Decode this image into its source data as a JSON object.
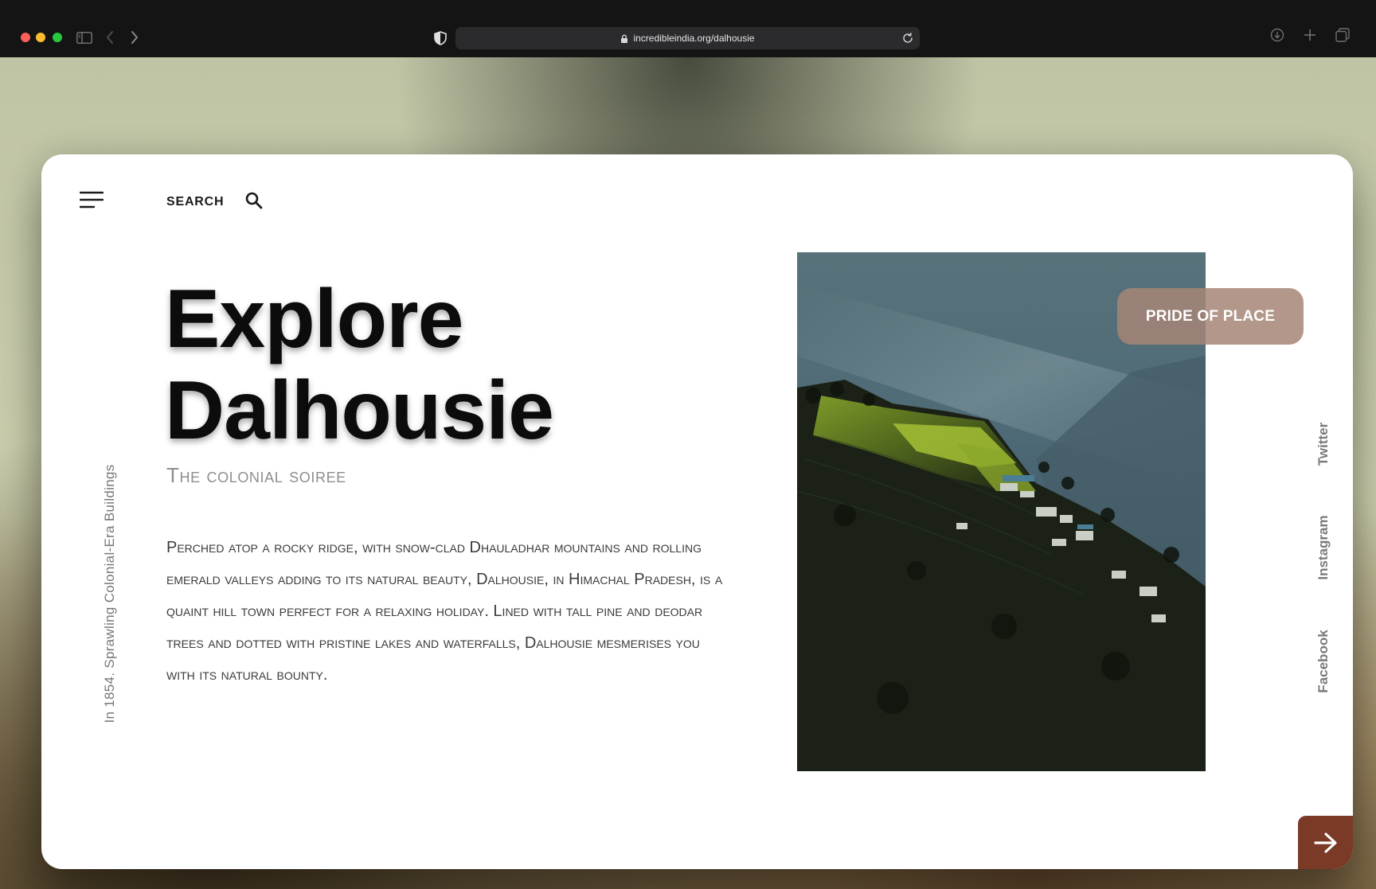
{
  "browser": {
    "url": "incredibleindia.org/dalhousie"
  },
  "header": {
    "search_label": "SEARCH"
  },
  "hero": {
    "title_line1": "Explore",
    "title_line2": "Dalhousie",
    "subtitle": "The colonial soiree",
    "body": "Perched atop a rocky ridge, with snow-clad Dhauladhar mountains and rolling emerald valleys adding to its natural beauty, Dalhousie, in Himachal Pradesh, is a quaint hill town perfect for a relaxing holiday. Lined with tall pine and deodar trees and dotted with pristine lakes and waterfalls, Dalhousie mesmerises you with its natural bounty."
  },
  "side_caption": "In 1854. Sprawling Colonial-Era Buildings",
  "badge": {
    "label": "PRIDE OF PLACE"
  },
  "social": {
    "twitter": "Twitter",
    "instagram": "Instagram",
    "facebook": "Facebook"
  },
  "icons": {
    "menu": "menu-icon",
    "search": "search-icon",
    "next": "arrow-right-icon"
  },
  "colors": {
    "accent": "#7a3a26",
    "badge": "#a68577"
  }
}
